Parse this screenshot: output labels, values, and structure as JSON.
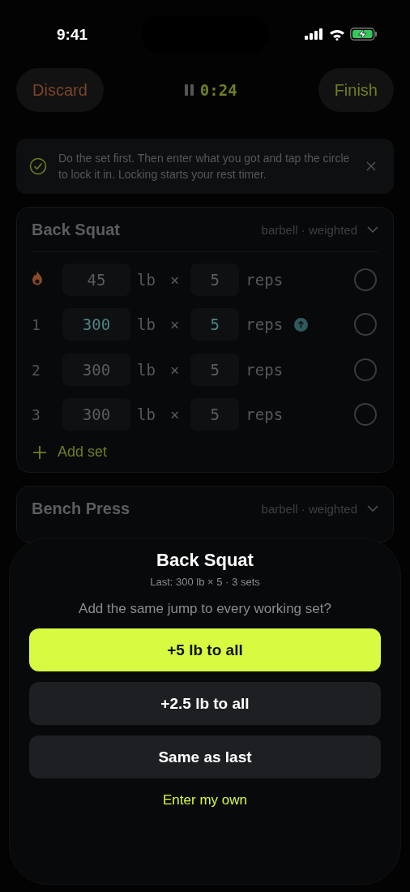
{
  "status_bar": {
    "time": "9:41"
  },
  "header": {
    "discard": "Discard",
    "timer": "0:24",
    "paused": true,
    "finish": "Finish"
  },
  "tip": {
    "text": "Do the set first. Then enter what you got and tap the circle to lock it in. Locking starts your rest timer."
  },
  "exercises": [
    {
      "name": "Back Squat",
      "meta": "barbell · weighted",
      "add_label": "Add set",
      "sets": [
        {
          "kind": "warmup",
          "weight": "45",
          "unit": "lb",
          "times": "×",
          "reps": "5",
          "reps_unit": "reps",
          "increased": false,
          "done": false
        },
        {
          "kind": "working",
          "label": "1",
          "weight": "300",
          "unit": "lb",
          "times": "×",
          "reps": "5",
          "reps_unit": "reps",
          "increased": true,
          "done": false
        },
        {
          "kind": "working",
          "label": "2",
          "weight": "300",
          "unit": "lb",
          "times": "×",
          "reps": "5",
          "reps_unit": "reps",
          "increased": false,
          "done": false
        },
        {
          "kind": "working",
          "label": "3",
          "weight": "300",
          "unit": "lb",
          "times": "×",
          "reps": "5",
          "reps_unit": "reps",
          "increased": false,
          "done": false
        }
      ]
    },
    {
      "name": "Bench Press",
      "meta": "barbell · weighted"
    }
  ],
  "sheet": {
    "title": "Back Squat",
    "subtitle": "Last: 300 lb × 5 · 3 sets",
    "question": "Add the same jump to every working set?",
    "options": [
      {
        "kind": "primary",
        "label": "+5 lb to all"
      },
      {
        "kind": "secondary",
        "label": "+2.5 lb to all"
      },
      {
        "kind": "secondary",
        "label": "Same as last"
      },
      {
        "kind": "link",
        "label": "Enter my own"
      }
    ]
  }
}
